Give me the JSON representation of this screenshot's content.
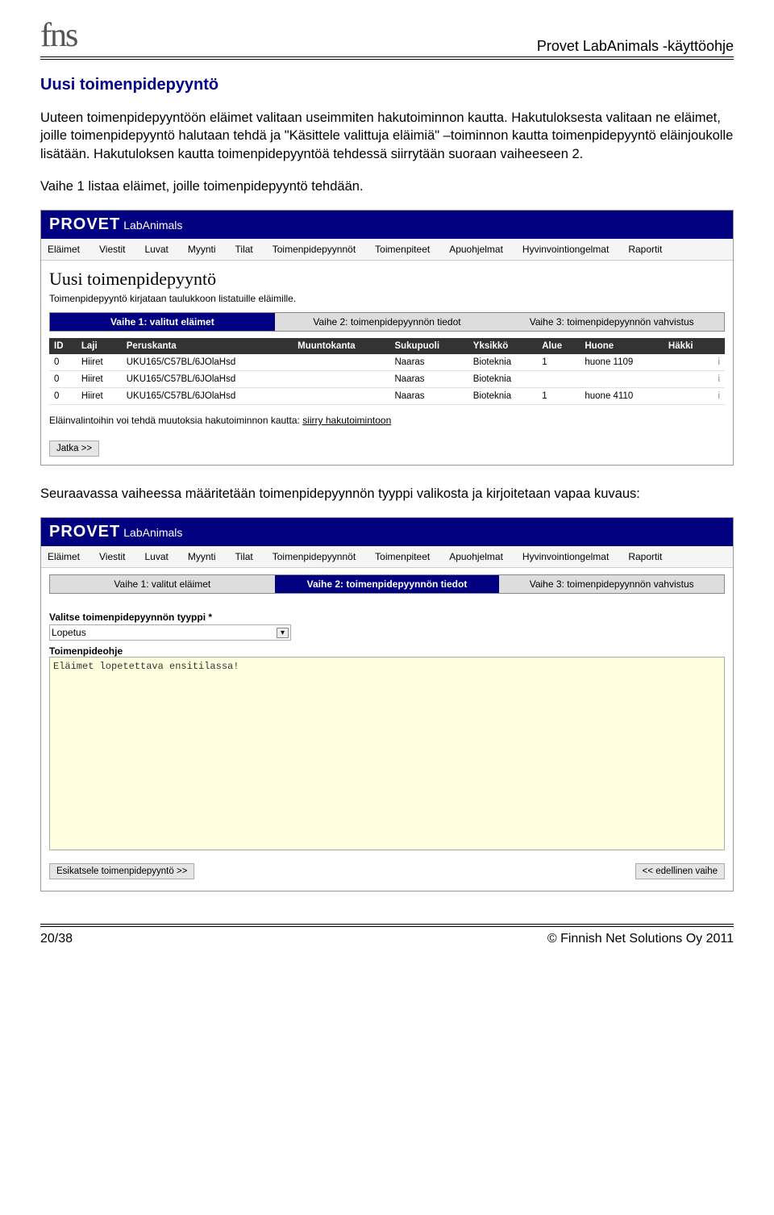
{
  "header": {
    "logo": "fns",
    "doc_title": "Provet LabAnimals -käyttöohje"
  },
  "section_title": "Uusi toimenpidepyyntö",
  "paragraph1": "Uuteen toimenpidepyyntöön eläimet valitaan useimmiten hakutoiminnon kautta. Hakutuloksesta valitaan ne eläimet, joille toimenpidepyyntö halutaan tehdä ja \"Käsittele valittuja eläimiä\" –toiminnon kautta toimenpidepyyntö eläinjoukolle lisätään. Hakutuloksen kautta toimenpidepyyntöä tehdessä siirrytään suoraan vaiheeseen 2.",
  "paragraph2": "Vaihe 1 listaa eläimet, joille toimenpidepyyntö tehdään.",
  "paragraph3": "Seuraavassa vaiheessa määritetään toimenpidepyynnön tyyppi valikosta ja kirjoitetaan vapaa kuvaus:",
  "app": {
    "brand": "PROVET",
    "sub": "LabAnimals",
    "menu": [
      "Eläimet",
      "Viestit",
      "Luvat",
      "Myynti",
      "Tilat",
      "Toimenpidepyynnöt",
      "Toimenpiteet",
      "Apuohjelmat",
      "Hyvinvointiongelmat",
      "Raportit"
    ]
  },
  "shot1": {
    "h1": "Uusi toimenpidepyyntö",
    "subtext": "Toimenpidepyyntö kirjataan taulukkoon listatuille eläimille.",
    "stages": [
      "Vaihe 1: valitut eläimet",
      "Vaihe 2: toimenpidepyynnön tiedot",
      "Vaihe 3: toimenpidepyynnön vahvistus"
    ],
    "active_stage": 0,
    "columns": [
      "ID",
      "Laji",
      "Peruskanta",
      "Muuntokanta",
      "Sukupuoli",
      "Yksikkö",
      "Alue",
      "Huone",
      "Häkki"
    ],
    "rows": [
      {
        "id": "0",
        "laji": "Hiiret",
        "peruskanta": "UKU165/C57BL/6JOlaHsd",
        "muuntokanta": "",
        "sukupuoli": "Naaras",
        "yksikko": "Bioteknia",
        "alue": "1",
        "huone": "huone 1109",
        "hakki": ""
      },
      {
        "id": "0",
        "laji": "Hiiret",
        "peruskanta": "UKU165/C57BL/6JOlaHsd",
        "muuntokanta": "",
        "sukupuoli": "Naaras",
        "yksikko": "Bioteknia",
        "alue": "",
        "huone": "",
        "hakki": ""
      },
      {
        "id": "0",
        "laji": "Hiiret",
        "peruskanta": "UKU165/C57BL/6JOlaHsd",
        "muuntokanta": "",
        "sukupuoli": "Naaras",
        "yksikko": "Bioteknia",
        "alue": "1",
        "huone": "huone 4110",
        "hakki": ""
      }
    ],
    "link_line_text": "Eläinvalintoihin voi tehdä muutoksia hakutoiminnon kautta: ",
    "link_label": "siirry hakutoimintoon",
    "next_btn": "Jatka >>"
  },
  "shot2": {
    "stages": [
      "Vaihe 1: valitut eläimet",
      "Vaihe 2: toimenpidepyynnön tiedot",
      "Vaihe 3: toimenpidepyynnön vahvistus"
    ],
    "active_stage": 1,
    "type_label": "Valitse toimenpidepyynnön tyyppi *",
    "type_value": "Lopetus",
    "ohje_label": "Toimenpideohje",
    "ohje_value": "Eläimet lopetettava ensitilassa!",
    "preview_btn": "Esikatsele toimenpidepyyntö >>",
    "prev_btn": "<< edellinen vaihe"
  },
  "footer": {
    "page": "20/38",
    "copyright": "© Finnish Net Solutions Oy 2011"
  }
}
